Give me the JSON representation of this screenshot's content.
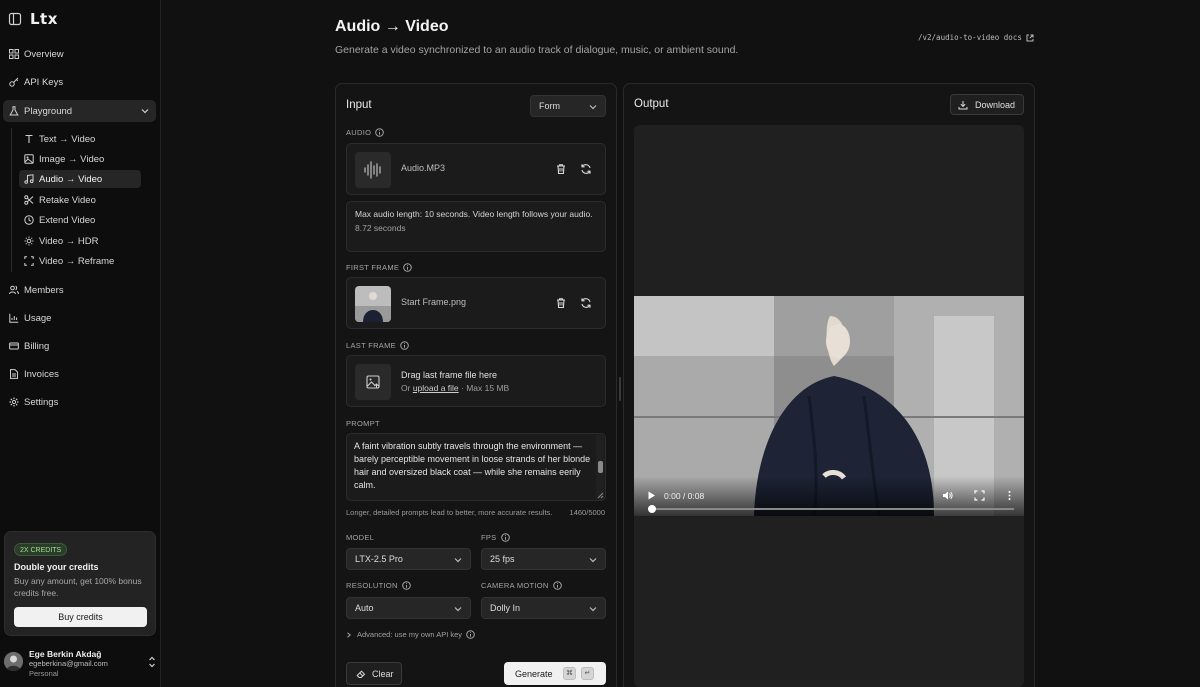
{
  "sidebar": {
    "logo": "Ltx",
    "nav": {
      "overview": "Overview",
      "api_keys": "API Keys",
      "playground": "Playground",
      "members": "Members",
      "usage": "Usage",
      "billing": "Billing",
      "invoices": "Invoices",
      "settings": "Settings"
    },
    "sub": {
      "text_video": "Text → Video",
      "image_video": "Image → Video",
      "audio_video": "Audio → Video",
      "retake_video": "Retake Video",
      "extend_video": "Extend Video",
      "video_hdr": "Video → HDR",
      "video_reframe": "Video → Reframe"
    },
    "promo": {
      "badge": "2X CREDITS",
      "title": "Double your credits",
      "text": "Buy any amount, get 100% bonus credits free.",
      "button": "Buy credits"
    },
    "user": {
      "name": "Ege Berkin Akdağ",
      "email": "egeberkina@gmail.com",
      "plan": "Personal"
    }
  },
  "header": {
    "title": "Audio → Video",
    "subtitle": "Generate a video synchronized to an audio track of dialogue, music, or ambient sound.",
    "docs_link": "/v2/audio-to-video docs"
  },
  "input": {
    "title": "Input",
    "mode": "Form",
    "audio": {
      "label": "AUDIO",
      "file": "Audio.MP3",
      "info": "Max audio length: 10 seconds. Video length follows your audio.",
      "duration": "8.72 seconds"
    },
    "first_frame": {
      "label": "FIRST FRAME",
      "file": "Start Frame.png"
    },
    "last_frame": {
      "label": "LAST FRAME",
      "drop_title": "Drag last frame file here",
      "drop_or": "Or ",
      "drop_link": "upload a file",
      "drop_max": " · Max 15 MB"
    },
    "prompt": {
      "label": "PROMPT",
      "value": "A faint vibration subtly travels through the environment — barely perceptible movement in loose strands of her blonde hair and oversized black coat — while she remains eerily calm.",
      "hint": "Longer, detailed prompts lead to better, more accurate results.",
      "counter": "1460/5000"
    },
    "model": {
      "label": "MODEL",
      "value": "LTX-2.5 Pro"
    },
    "fps": {
      "label": "FPS",
      "value": "25 fps"
    },
    "resolution": {
      "label": "RESOLUTION",
      "value": "Auto"
    },
    "camera_motion": {
      "label": "CAMERA MOTION",
      "value": "Dolly In"
    },
    "advanced": "Advanced: use my own API key",
    "clear": "Clear",
    "generate": "Generate",
    "kbd_cmd": "⌘",
    "kbd_enter": "↵"
  },
  "output": {
    "title": "Output",
    "download": "Download",
    "video_time": "0:00 / 0:08",
    "progress": 0.0
  }
}
